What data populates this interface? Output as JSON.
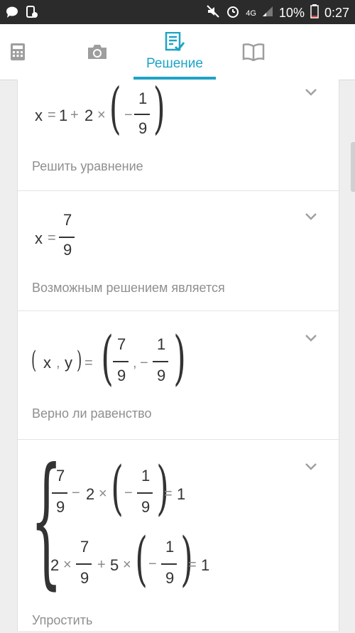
{
  "status_bar": {
    "network": "4G",
    "battery": "10%",
    "time": "0:27"
  },
  "tabs": {
    "calculator_icon": "calculator-icon",
    "camera_icon": "camera-icon",
    "solution_label": "Решение",
    "book_icon": "book-icon",
    "accent_color": "#1fa3c7"
  },
  "cards": {
    "card1": {
      "var": "x",
      "eq": "=",
      "one": "1",
      "plus": "+",
      "two": "2",
      "times": "×",
      "minus": "−",
      "num": "1",
      "den": "9",
      "caption": "Решить уравнение"
    },
    "card2": {
      "var": "x",
      "eq": "=",
      "num": "7",
      "den": "9",
      "caption": "Возможным решением является"
    },
    "card3": {
      "x": "x",
      "comma": ",",
      "y": "y",
      "eq": "=",
      "num1": "7",
      "den1": "9",
      "comma2": ",",
      "minus": "−",
      "num2": "1",
      "den2": "9",
      "caption": "Верно ли равенство"
    },
    "card4": {
      "r1_num": "7",
      "r1_den": "9",
      "r1_minus": "−",
      "r1_two": "2",
      "r1_times": "×",
      "r1_neg": "−",
      "r1_num2": "1",
      "r1_den2": "9",
      "r1_eq": "=",
      "r1_rhs": "1",
      "r2_two": "2",
      "r2_times": "×",
      "r2_num": "7",
      "r2_den": "9",
      "r2_plus": "+",
      "r2_five": "5",
      "r2_times2": "×",
      "r2_neg": "−",
      "r2_num2": "1",
      "r2_den2": "9",
      "r2_eq": "=",
      "r2_rhs": "1",
      "caption": "Упростить"
    }
  }
}
